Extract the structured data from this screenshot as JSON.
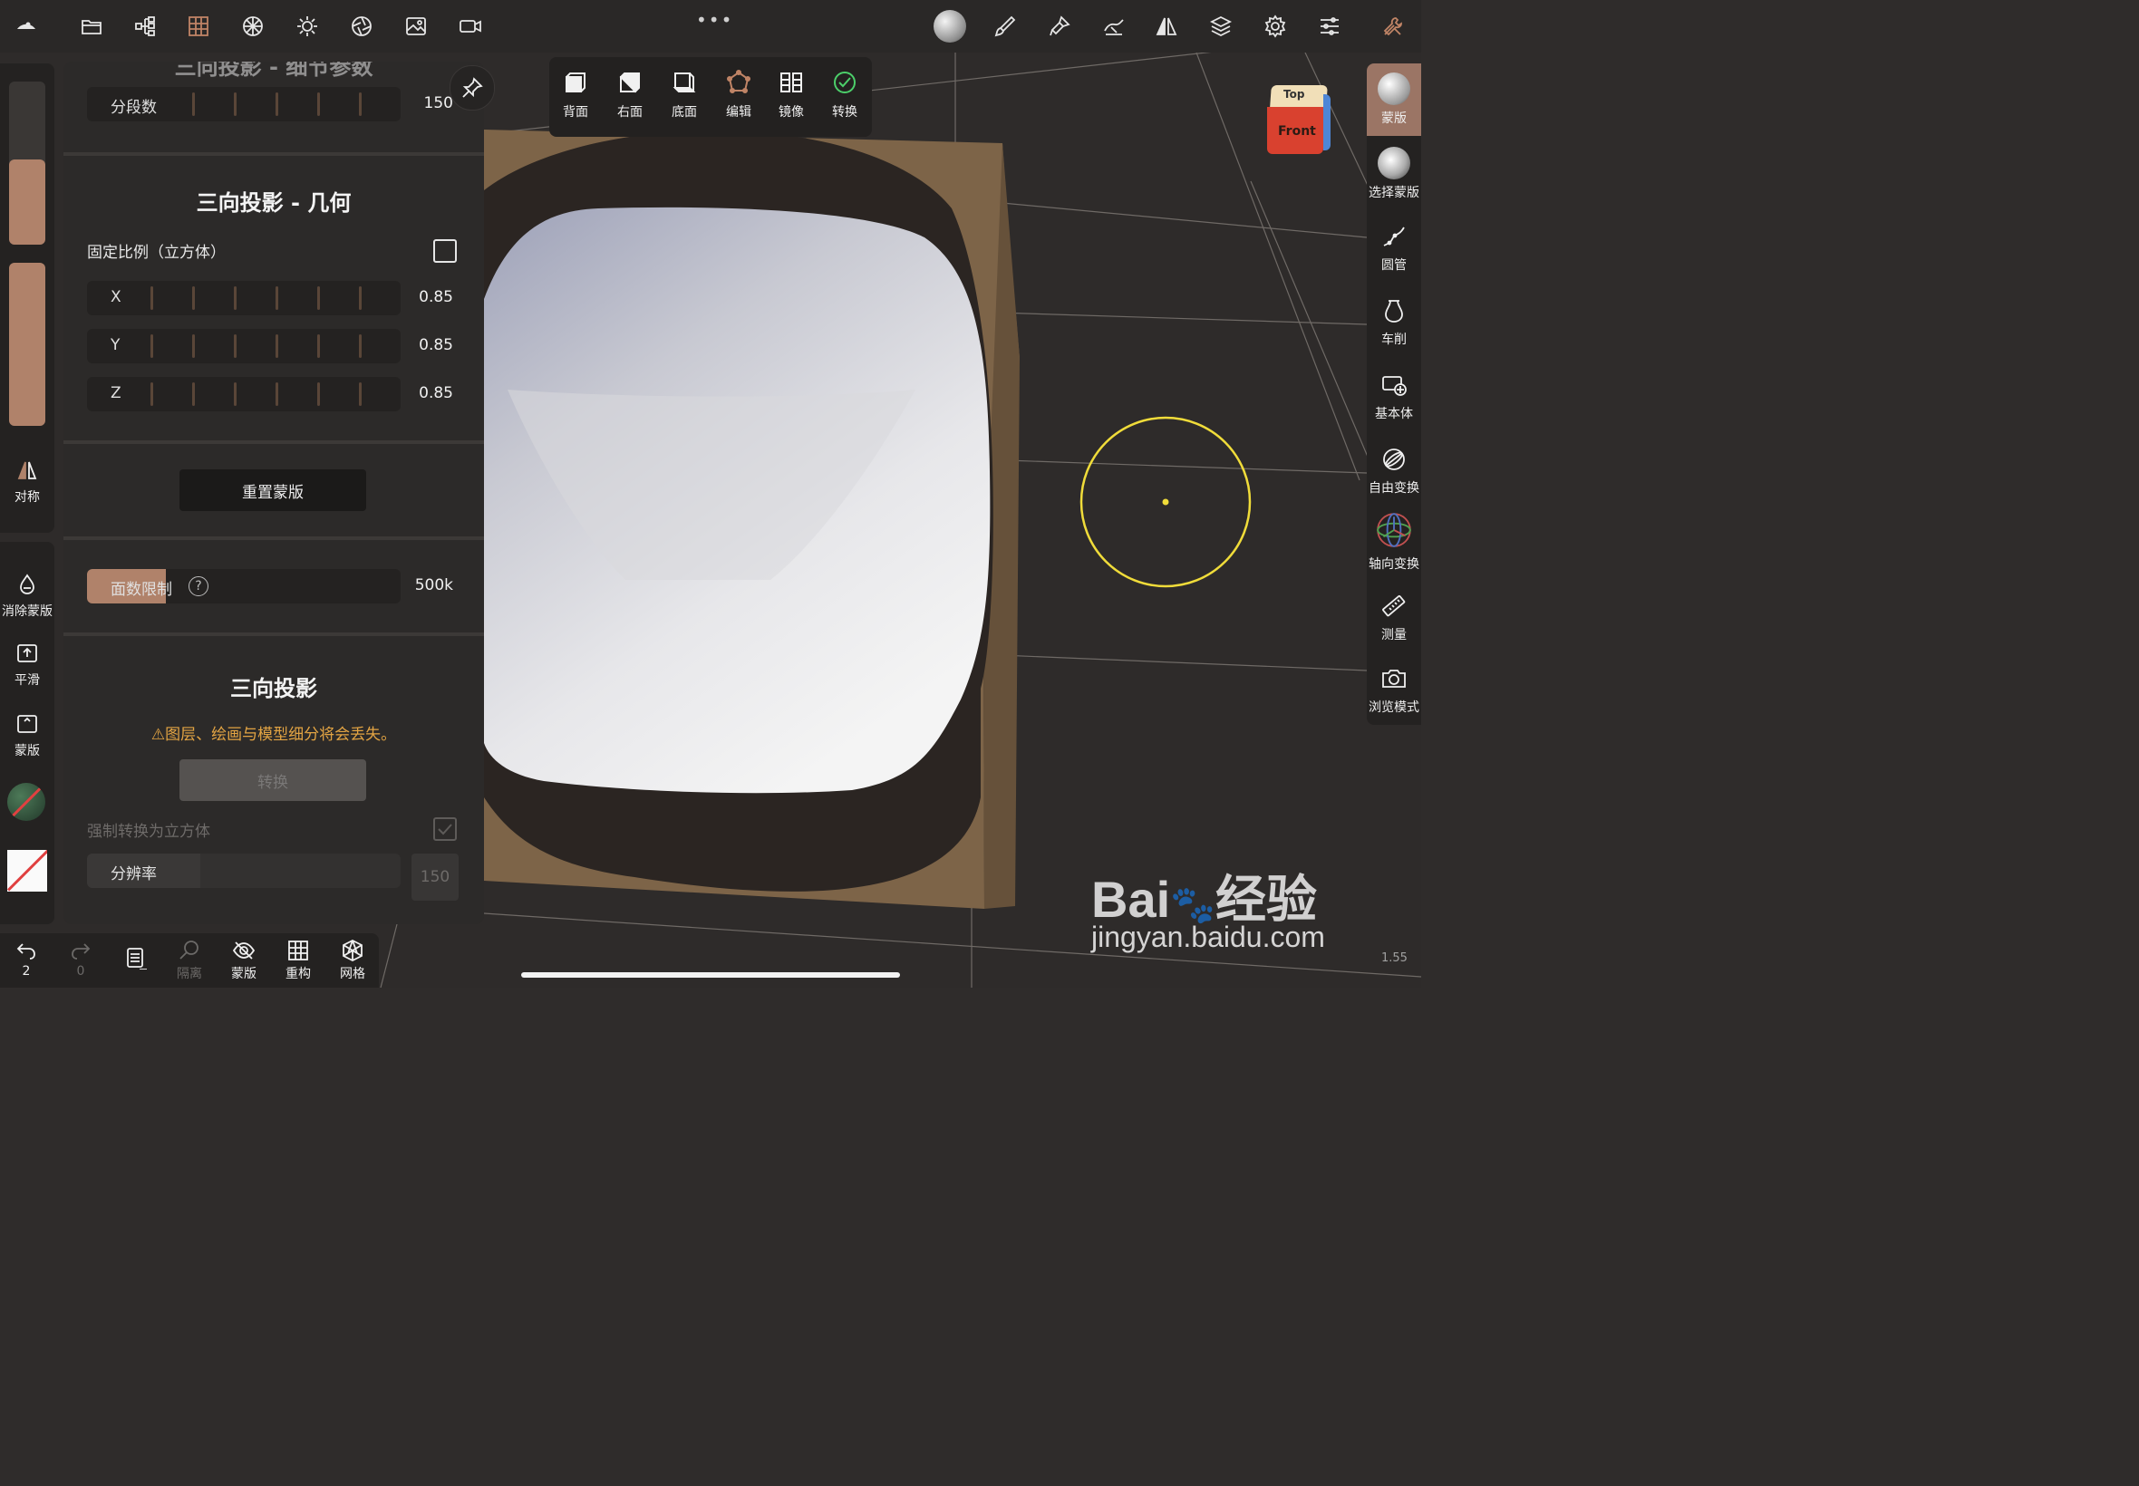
{
  "topbar": {
    "icons": [
      "logo-icon",
      "folder-icon",
      "scene-tree-icon",
      "grid-icon",
      "topology-sphere-icon",
      "light-icon",
      "aperture-icon",
      "image-icon",
      "video-icon",
      "material-sphere-icon",
      "brush-icon",
      "paint-icon",
      "stroke-icon",
      "symmetry-icon",
      "layers-icon",
      "settings-icon",
      "sliders-icon",
      "tools-icon"
    ]
  },
  "view_panel": {
    "buttons": [
      {
        "label": "背面",
        "icon": "back-view-icon"
      },
      {
        "label": "右面",
        "icon": "right-view-icon"
      },
      {
        "label": "底面",
        "icon": "bottom-view-icon"
      },
      {
        "label": "编辑",
        "icon": "edit-icon"
      },
      {
        "label": "镜像",
        "icon": "mirror-icon"
      },
      {
        "label": "转换",
        "icon": "check-icon"
      }
    ]
  },
  "left_toolbar": {
    "symmetry_label": "对称",
    "items": [
      {
        "label": "消除蒙版",
        "icon": "drop-icon"
      },
      {
        "label": "平滑",
        "icon": "smooth-icon"
      },
      {
        "label": "蒙版",
        "icon": "mask-icon"
      }
    ],
    "size_slider_fraction": 0.52,
    "intensity_slider_fraction": 1.0
  },
  "panel": {
    "top_partial_title": "三向投影 - 细节参数",
    "segments": {
      "label": "分段数",
      "value": "150"
    },
    "geometry": {
      "title": "三向投影 - 几何",
      "fixed_ratio_label": "固定比例（立方体）",
      "axes": [
        {
          "label": "X",
          "value": "0.85"
        },
        {
          "label": "Y",
          "value": "0.85"
        },
        {
          "label": "Z",
          "value": "0.85"
        }
      ]
    },
    "reset_mask_label": "重置蒙版",
    "face_limit": {
      "label": "面数限制",
      "help": "?",
      "value": "500k",
      "fill_fraction": 0.25
    },
    "triplanar": {
      "title": "三向投影",
      "warning": "⚠图层、绘画与模型细分将会丢失。",
      "convert_label": "转换",
      "force_cube_label": "强制转换为立方体",
      "resolution_label": "分辨率",
      "resolution_value": "150"
    }
  },
  "right_toolbar": {
    "items": [
      {
        "label": "蒙版",
        "icon": "mask-sphere-icon",
        "active": true
      },
      {
        "label": "选择蒙版",
        "icon": "select-mask-icon"
      },
      {
        "label": "圆管",
        "icon": "tube-icon"
      },
      {
        "label": "车削",
        "icon": "lathe-icon"
      },
      {
        "label": "基本体",
        "icon": "primitive-icon"
      },
      {
        "label": "自由变换",
        "icon": "free-transform-icon"
      },
      {
        "label": "轴向变换",
        "icon": "gizmo-icon"
      },
      {
        "label": "测量",
        "icon": "ruler-icon"
      },
      {
        "label": "浏览模式",
        "icon": "camera-icon"
      }
    ]
  },
  "view_cube": {
    "top": "Top",
    "front": "Front"
  },
  "bottom_bar": {
    "undo_count": "2",
    "redo_count": "0",
    "items": [
      {
        "label": "隔离",
        "icon": "search-icon",
        "dim": true
      },
      {
        "label": "蒙版",
        "icon": "eye-off-icon"
      },
      {
        "label": "重构",
        "icon": "remesh-grid-icon"
      },
      {
        "label": "网格",
        "icon": "wireframe-icon"
      }
    ]
  },
  "watermark": {
    "brand": "Bai",
    "brand_suffix": "经验",
    "url": "jingyan.baidu.com"
  },
  "version": "1.55"
}
